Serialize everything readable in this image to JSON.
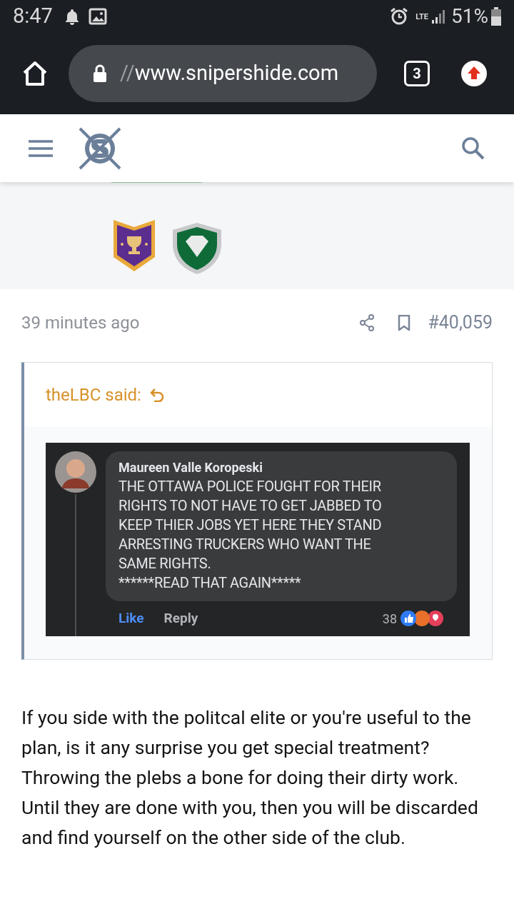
{
  "status_bar": {
    "time": "8:47",
    "network": "LTE",
    "battery": "51%"
  },
  "browser": {
    "url_faded": "//",
    "url": "www.snipershide.com",
    "tab_count": "3"
  },
  "post": {
    "time": "39 minutes ago",
    "number": "#40,059",
    "quote": {
      "author": "theLBC said:",
      "comment": {
        "name": "Maureen Valle Koropeski",
        "lines": [
          "THE OTTAWA POLICE FOUGHT FOR THEIR",
          "RIGHTS TO NOT HAVE TO GET JABBED TO",
          "KEEP THIER JOBS YET HERE THEY STAND",
          "ARRESTING TRUCKERS WHO WANT THE",
          "SAME RIGHTS.",
          "******READ THAT AGAIN*****"
        ],
        "like": "Like",
        "reply": "Reply",
        "reaction_count": "38"
      }
    },
    "body": "If you side with the politcal elite or you're useful to the plan, is it any surprise you get special treatment? Throwing the plebs a bone for doing their dirty work. Until they are done with you, then you will be discarded and find yourself on the other side of the club."
  }
}
